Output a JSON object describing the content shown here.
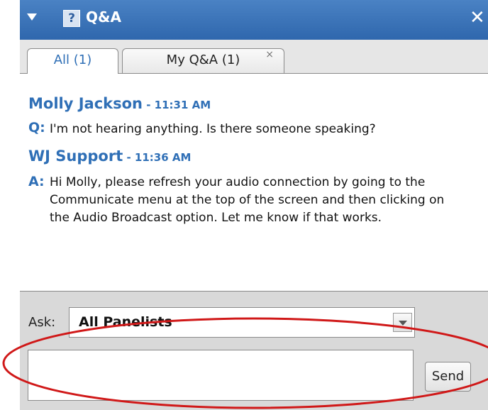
{
  "window": {
    "title": "Q&A",
    "help_glyph": "?",
    "close_glyph": "✕"
  },
  "tabs": [
    {
      "label": "All (1)",
      "active": true
    },
    {
      "label": "My Q&A (1)",
      "active": false,
      "close_glyph": "×"
    }
  ],
  "messages": [
    {
      "author": "Molly Jackson",
      "time": " - 11:31 AM",
      "label": "Q:",
      "lines": [
        "I'm not hearing anything. Is there someone speaking?"
      ]
    },
    {
      "author": "WJ Support",
      "time": " - 11:36 AM",
      "label": "A:",
      "lines": [
        "Hi Molly, please refresh your audio connection by going to the",
        "Communicate menu at the top of the screen and then clicking on",
        "the Audio Broadcast option. Let me know if that works."
      ]
    }
  ],
  "ask": {
    "label": "Ask:",
    "selected": "All Panelists"
  },
  "input": {
    "value": ""
  },
  "send_label": "Send",
  "colors": {
    "title_bar": "#2f67ad",
    "accent": "#2f6fb6",
    "highlight_ring": "#d01818"
  }
}
